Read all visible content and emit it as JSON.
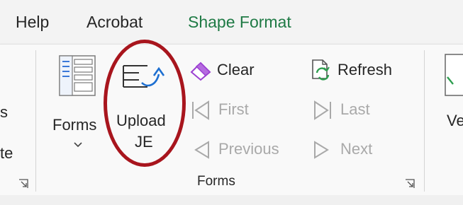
{
  "menu": {
    "tabs": [
      {
        "label": "Help"
      },
      {
        "label": "Acrobat"
      },
      {
        "label": "Shape Format",
        "active": true
      }
    ]
  },
  "ribbon": {
    "left_partial": {
      "top": "s",
      "bottom": "te"
    },
    "forms_group": {
      "label": "Forms",
      "forms_button": {
        "label": "Forms",
        "icon": "form-icon",
        "dropdown_icon": "chevron-down-icon"
      },
      "upload_button": {
        "line1": "Upload",
        "line2": "JE",
        "icon": "upload-icon"
      },
      "clear_button": {
        "label": "Clear",
        "icon": "eraser-icon"
      },
      "first_button": {
        "label": "First",
        "icon": "first-arrow-icon",
        "disabled": true
      },
      "previous_button": {
        "label": "Previous",
        "icon": "previous-arrow-icon",
        "disabled": true
      },
      "refresh_button": {
        "label": "Refresh",
        "icon": "refresh-icon"
      },
      "last_button": {
        "label": "Last",
        "icon": "last-arrow-icon",
        "disabled": true
      },
      "next_button": {
        "label": "Next",
        "icon": "next-arrow-icon",
        "disabled": true
      }
    },
    "right_partial": {
      "label": "Ve"
    }
  },
  "colors": {
    "accent_green": "#1f7a45",
    "highlight_red": "#a8151d",
    "eraser_purple": "#9b3fd1",
    "upload_blue": "#1d6fd1",
    "disabled_gray": "#a9a9a9"
  }
}
